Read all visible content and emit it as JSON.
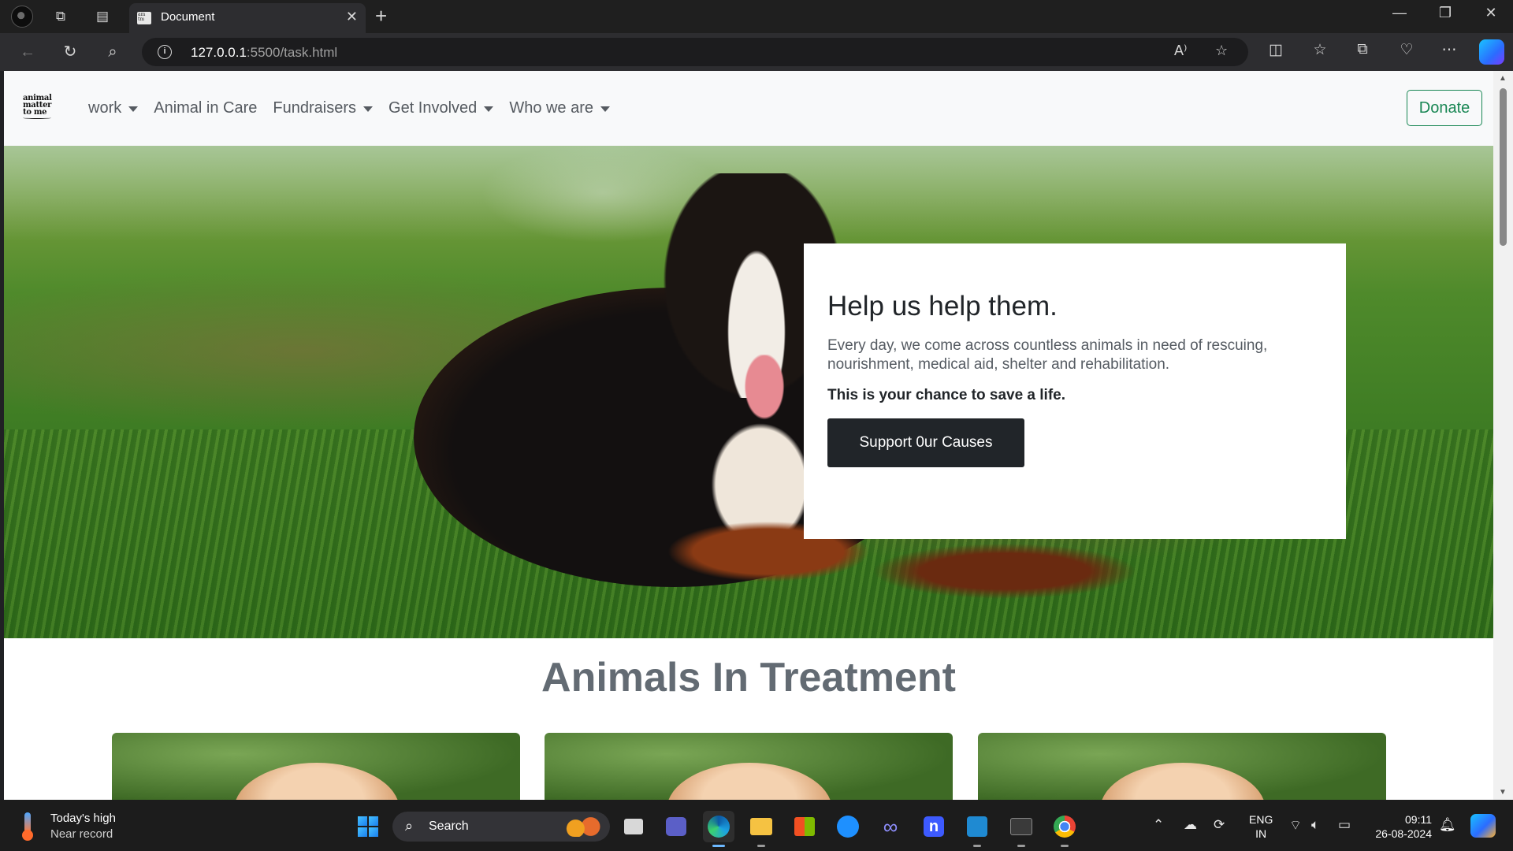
{
  "browser": {
    "tab_title": "Document",
    "url_host": "127.0.0.1",
    "url_rest": ":5500/task.html",
    "new_tab": "+",
    "read_aloud": "A⁾"
  },
  "site": {
    "logo_lines": [
      "animal",
      "matter",
      "to me"
    ],
    "nav": {
      "items": [
        {
          "label": "work",
          "dropdown": true
        },
        {
          "label": "Animal in Care",
          "dropdown": false
        },
        {
          "label": "Fundraisers",
          "dropdown": true
        },
        {
          "label": "Get Involved",
          "dropdown": true
        },
        {
          "label": "Who we are",
          "dropdown": true
        }
      ],
      "donate": "Donate"
    },
    "hero": {
      "title": "Help us help them.",
      "text": "Every day, we come across countless animals in need of rescuing, nourishment, medical aid, shelter and rehabilitation.",
      "strong": "This is your chance to save a life.",
      "button": "Support 0ur Causes"
    },
    "section_title": "Animals In Treatment",
    "card_count": 3
  },
  "taskbar": {
    "weather_line1": "Today's high",
    "weather_line2": "Near record",
    "search": "Search",
    "lang_line1": "ENG",
    "lang_line2": "IN",
    "time": "09:11",
    "date": "26-08-2024"
  },
  "colors": {
    "accent_green": "#198754",
    "dark_button": "#212529",
    "section_title": "#636b73"
  }
}
